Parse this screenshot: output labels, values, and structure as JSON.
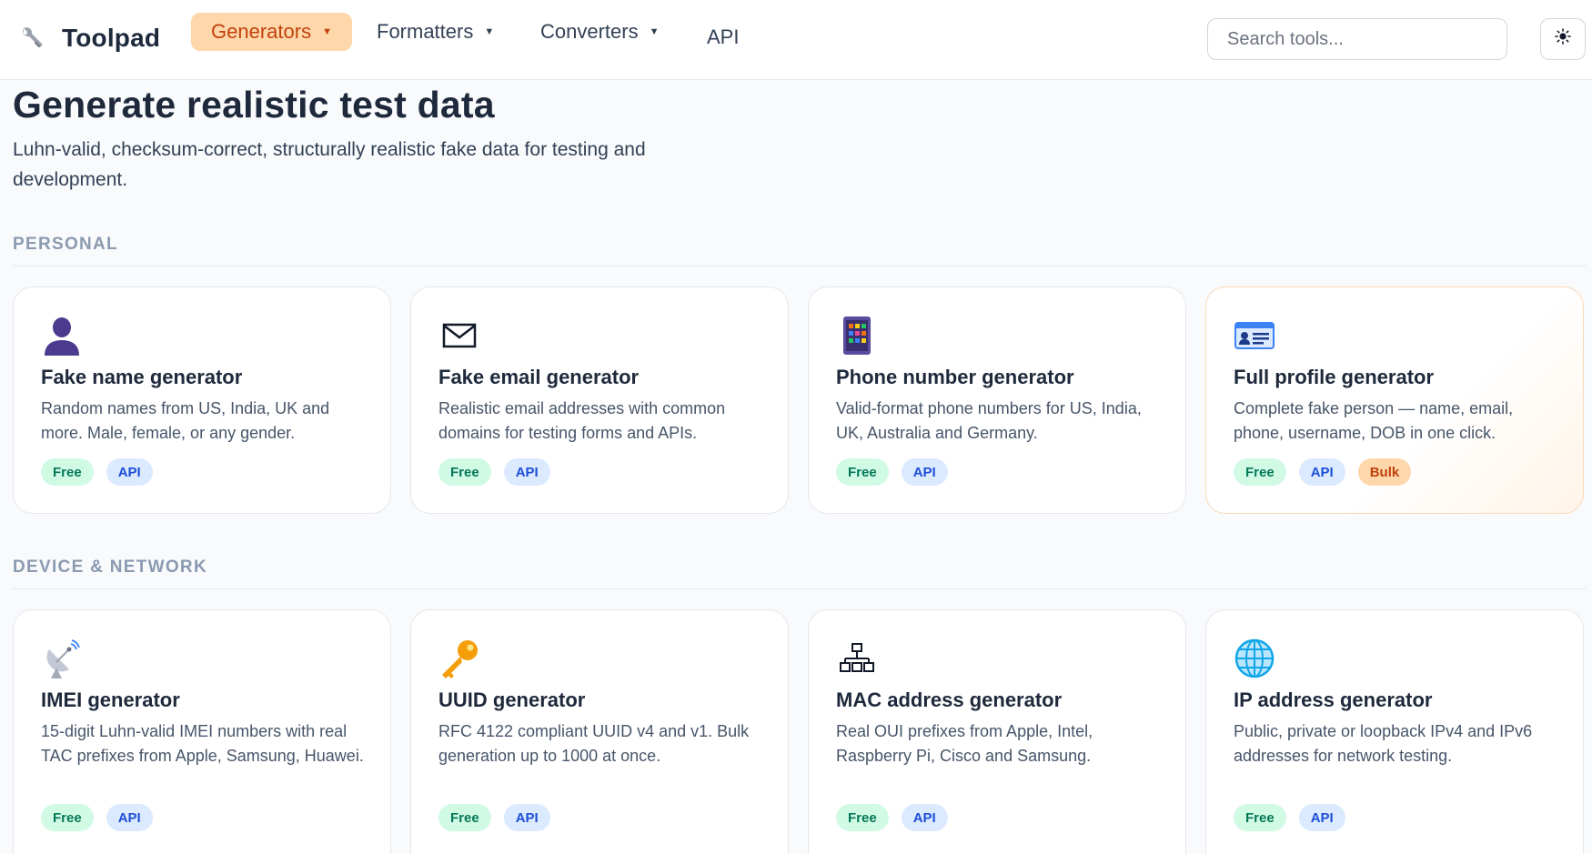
{
  "header": {
    "brand": "Toolpad",
    "nav": {
      "generators": "Generators",
      "formatters": "Formatters",
      "converters": "Converters",
      "api": "API"
    },
    "search_placeholder": "Search tools...",
    "theme_icon": "sun-icon"
  },
  "hero": {
    "title": "Generate realistic test data",
    "subtitle": "Luhn-valid, checksum-correct, structurally realistic fake data for testing and development."
  },
  "sections": [
    {
      "label": "PERSONAL",
      "cards": [
        {
          "title": "Fake name generator",
          "desc": "Random names from US, India, UK and more. Male, female, or any gender.",
          "icon": "person-silhouette-icon",
          "badges": [
            "Free",
            "API"
          ]
        },
        {
          "title": "Fake email generator",
          "desc": "Realistic email addresses with common domains for testing forms and APIs.",
          "icon": "envelope-icon",
          "badges": [
            "Free",
            "API"
          ]
        },
        {
          "title": "Phone number generator",
          "desc": "Valid-format phone numbers for US, India, UK, Australia and Germany.",
          "icon": "mobile-phone-icon",
          "badges": [
            "Free",
            "API"
          ]
        },
        {
          "title": "Full profile generator",
          "desc": "Complete fake person — name, email, phone, username, DOB in one click.",
          "icon": "id-card-icon",
          "badges": [
            "Free",
            "API",
            "Bulk"
          ]
        }
      ]
    },
    {
      "label": "DEVICE & NETWORK",
      "cards": [
        {
          "title": "IMEI generator",
          "desc": "15-digit Luhn-valid IMEI numbers with real TAC prefixes from Apple, Samsung, Huawei.",
          "icon": "satellite-dish-icon",
          "badges": [
            "Free",
            "API"
          ]
        },
        {
          "title": "UUID generator",
          "desc": "RFC 4122 compliant UUID v4 and v1. Bulk generation up to 1000 at once.",
          "icon": "key-icon",
          "badges": [
            "Free",
            "API"
          ]
        },
        {
          "title": "MAC address generator",
          "desc": "Real OUI prefixes from Apple, Intel, Raspberry Pi, Cisco and Samsung.",
          "icon": "network-icon",
          "badges": [
            "Free",
            "API"
          ]
        },
        {
          "title": "IP address generator",
          "desc": "Public, private or loopback IPv4 and IPv6 addresses for network testing.",
          "icon": "globe-icon",
          "badges": [
            "Free",
            "API"
          ]
        }
      ]
    }
  ],
  "colors": {
    "accent": "#fed7aa",
    "accent_text": "#c2410c",
    "badge_free": "#d1fae5",
    "badge_api": "#dbeafe",
    "badge_bulk": "#fed7aa"
  }
}
